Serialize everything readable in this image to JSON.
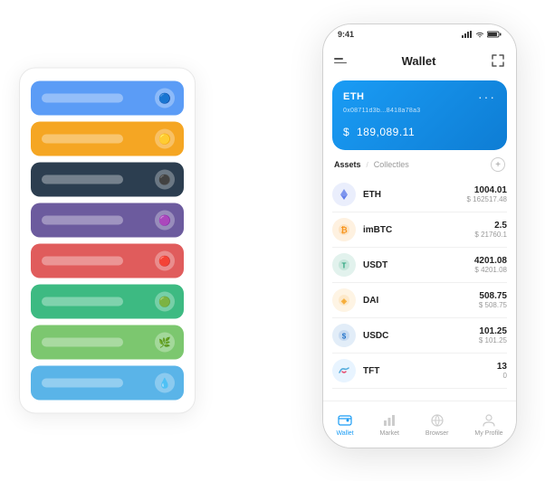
{
  "scene": {
    "cardStack": {
      "cards": [
        {
          "color": "card-blue",
          "id": "blue"
        },
        {
          "color": "card-yellow",
          "id": "yellow"
        },
        {
          "color": "card-dark",
          "id": "dark"
        },
        {
          "color": "card-purple",
          "id": "purple"
        },
        {
          "color": "card-red",
          "id": "red"
        },
        {
          "color": "card-green",
          "id": "green"
        },
        {
          "color": "card-light-green",
          "id": "light-green"
        },
        {
          "color": "card-light-blue",
          "id": "light-blue"
        }
      ]
    },
    "phone": {
      "statusBar": {
        "time": "9:41",
        "icons": "signal wifi battery"
      },
      "header": {
        "title": "Wallet"
      },
      "balanceCard": {
        "coin": "ETH",
        "address": "0x08711d3b...8418a78a3",
        "currencySymbol": "$",
        "amount": "189,089.11"
      },
      "assetsSection": {
        "tabActive": "Assets",
        "tabDivider": "/",
        "tabInactive": "Collectles",
        "addLabel": "+"
      },
      "assets": [
        {
          "symbol": "ETH",
          "name": "ETH",
          "iconType": "eth",
          "amount": "1004.01",
          "value": "$ 162517.48"
        },
        {
          "symbol": "imBTC",
          "name": "imBTC",
          "iconType": "imbtc",
          "amount": "2.5",
          "value": "$ 21760.1"
        },
        {
          "symbol": "USDT",
          "name": "USDT",
          "iconType": "usdt",
          "amount": "4201.08",
          "value": "$ 4201.08"
        },
        {
          "symbol": "DAI",
          "name": "DAI",
          "iconType": "dai",
          "amount": "508.75",
          "value": "$ 508.75"
        },
        {
          "symbol": "USDC",
          "name": "USDC",
          "iconType": "usdc",
          "amount": "101.25",
          "value": "$ 101.25"
        },
        {
          "symbol": "TFT",
          "name": "TFT",
          "iconType": "tft",
          "amount": "13",
          "value": "0"
        }
      ],
      "bottomNav": [
        {
          "label": "Wallet",
          "icon": "wallet",
          "active": true
        },
        {
          "label": "Market",
          "icon": "market",
          "active": false
        },
        {
          "label": "Browser",
          "icon": "browser",
          "active": false
        },
        {
          "label": "My Profile",
          "icon": "profile",
          "active": false
        }
      ]
    }
  }
}
